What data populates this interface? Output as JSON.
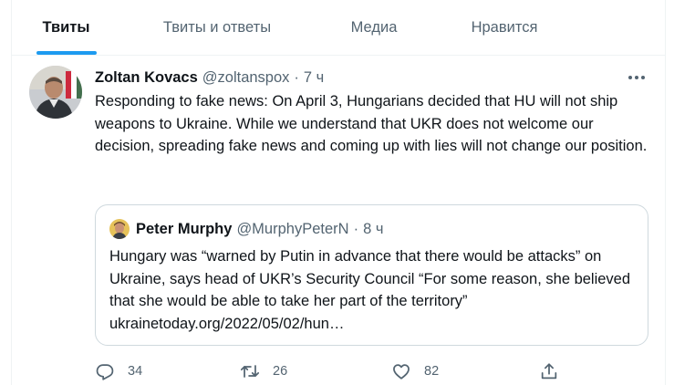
{
  "tabs": [
    {
      "label": "Твиты",
      "active": true
    },
    {
      "label": "Твиты и ответы",
      "active": false
    },
    {
      "label": "Медиа",
      "active": false
    },
    {
      "label": "Нравится",
      "active": false
    }
  ],
  "tweet": {
    "author_name": "Zoltan Kovacs",
    "author_handle": "@zoltanspox",
    "separator": "·",
    "time": "7 ч",
    "text": "Responding to fake news: On April 3, Hungarians decided that HU will not ship weapons to Ukraine. While we understand that UKR does not welcome our decision, spreading fake news and coming up with lies will not change our position."
  },
  "quote": {
    "author_name": "Peter Murphy",
    "author_handle": "@MurphyPeterN",
    "separator": "·",
    "time": "8 ч",
    "text": "Hungary was “warned by Putin in advance that there would be attacks” on Ukraine, says head of UKR’s Security Council “For some reason, she believed that she would be able to take her part of the territory” ukrainetoday.org/2022/05/02/hun…"
  },
  "actions": {
    "reply_count": "34",
    "retweet_count": "26",
    "like_count": "82"
  },
  "icons": {
    "more": "more-horizontal-icon",
    "reply": "reply-icon",
    "retweet": "retweet-icon",
    "like": "heart-icon",
    "share": "share-icon"
  },
  "colors": {
    "accent": "#1d9bf0",
    "text": "#0f1419",
    "secondary": "#536471",
    "border": "#cfd9de"
  }
}
